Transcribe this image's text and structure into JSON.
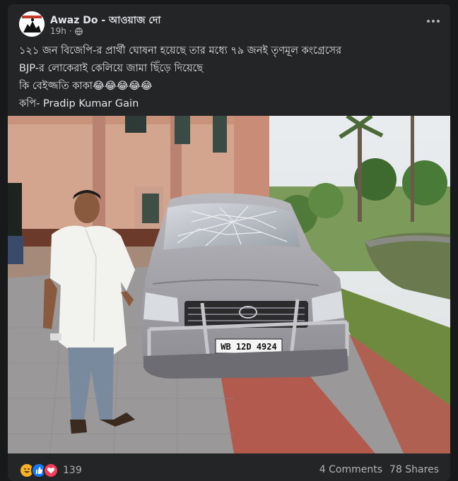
{
  "post": {
    "page_name": "Awaz Do - আওয়াজ দো",
    "time": "19h",
    "time_separator": "·",
    "privacy_icon": "globe-icon",
    "more_icon": "more-options-icon",
    "text_lines": [
      "১২১ জন বিজেপি-র প্রার্থী ঘোষনা হয়েছে তার মধ্যে ৭৯ জনই তৃণমূল কংগ্রেসের",
      "BJP-র লোকেরাই কেলিয়ে জামা ছিঁড়ে দিয়েছে",
      "কি বেইজ্জতি কাকা😂😂😂😂😂",
      "কপি- Pradip Kumar Gain"
    ]
  },
  "photo": {
    "license_plate": "WB 12D 4924"
  },
  "footer": {
    "reaction_icons": [
      "laugh-reaction-icon",
      "like-reaction-icon",
      "love-reaction-icon"
    ],
    "reaction_count": "139",
    "comments": "4 Comments",
    "shares": "78 Shares"
  },
  "colors": {
    "background": "#18191a",
    "card": "#242526",
    "text_primary": "#e4e6eb",
    "text_secondary": "#b0b3b8",
    "like_blue": "#1877f2",
    "love_red": "#f33e58",
    "haha_yellow": "#f7b125"
  }
}
